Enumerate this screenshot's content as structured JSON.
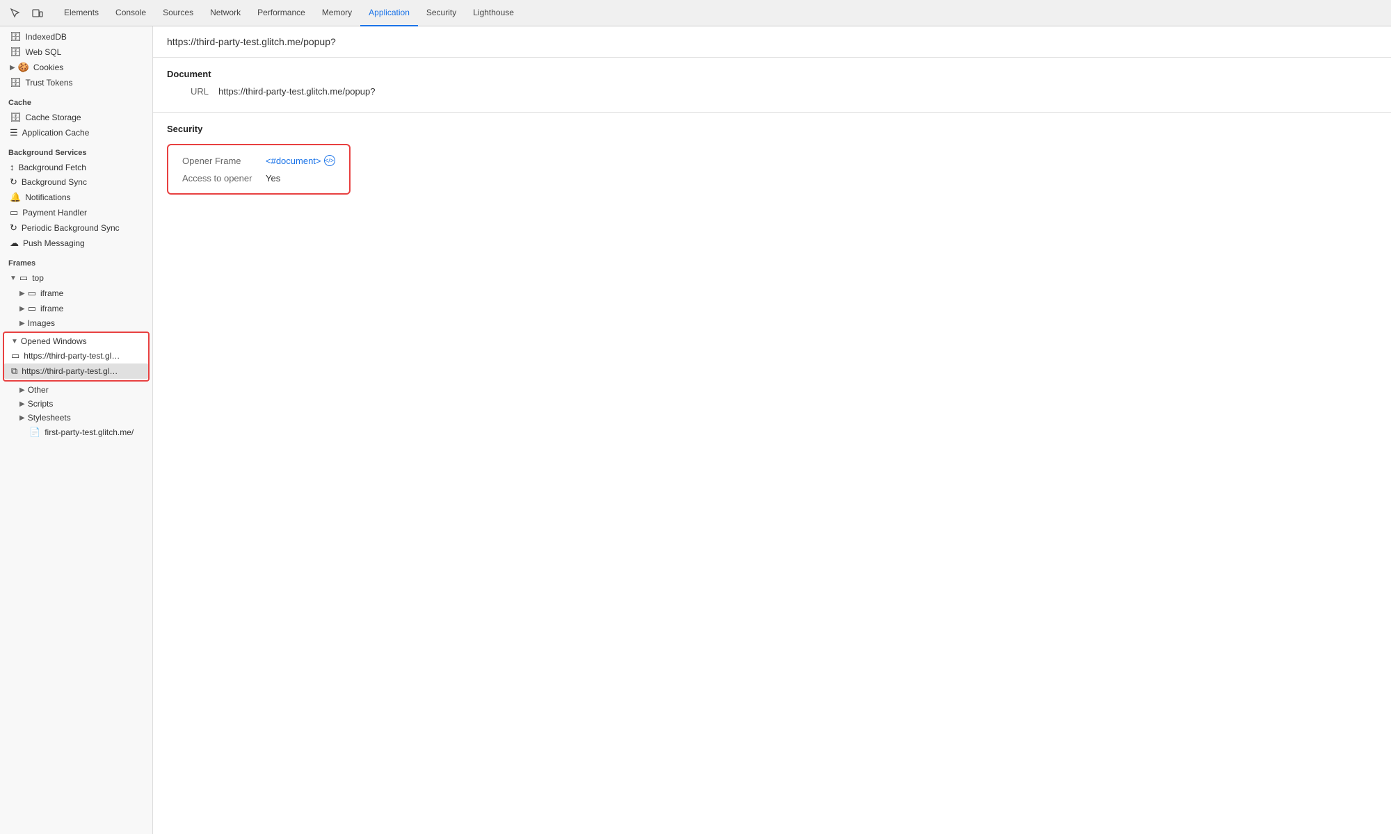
{
  "tabs": [
    {
      "label": "Elements",
      "active": false
    },
    {
      "label": "Console",
      "active": false
    },
    {
      "label": "Sources",
      "active": false
    },
    {
      "label": "Network",
      "active": false
    },
    {
      "label": "Performance",
      "active": false
    },
    {
      "label": "Memory",
      "active": false
    },
    {
      "label": "Application",
      "active": true
    },
    {
      "label": "Security",
      "active": false
    },
    {
      "label": "Lighthouse",
      "active": false
    }
  ],
  "sidebar": {
    "storage_items": [
      {
        "label": "IndexedDB",
        "icon": "🗄",
        "indent": 0
      },
      {
        "label": "Web SQL",
        "icon": "🗄",
        "indent": 0
      },
      {
        "label": "Cookies",
        "icon": "🍪",
        "indent": 0,
        "expandable": true
      },
      {
        "label": "Trust Tokens",
        "icon": "🗄",
        "indent": 0
      }
    ],
    "cache_header": "Cache",
    "cache_items": [
      {
        "label": "Cache Storage",
        "icon": "🗄",
        "indent": 0
      },
      {
        "label": "Application Cache",
        "icon": "☰",
        "indent": 0
      }
    ],
    "bg_header": "Background Services",
    "bg_items": [
      {
        "label": "Background Fetch",
        "icon": "↕",
        "indent": 0
      },
      {
        "label": "Background Sync",
        "icon": "↻",
        "indent": 0
      },
      {
        "label": "Notifications",
        "icon": "🔔",
        "indent": 0
      },
      {
        "label": "Payment Handler",
        "icon": "▭",
        "indent": 0
      },
      {
        "label": "Periodic Background Sync",
        "icon": "↻",
        "indent": 0
      },
      {
        "label": "Push Messaging",
        "icon": "☁",
        "indent": 0
      }
    ],
    "frames_header": "Frames",
    "frames_items": [
      {
        "label": "top",
        "icon": "▭",
        "indent": 0,
        "expandable": true,
        "expanded": true
      },
      {
        "label": "iframe",
        "icon": "▭",
        "indent": 1,
        "expandable": true
      },
      {
        "label": "iframe",
        "icon": "▭",
        "indent": 1,
        "expandable": true
      },
      {
        "label": "Images",
        "icon": "",
        "indent": 1,
        "expandable": true
      }
    ],
    "opened_windows_label": "Opened Windows",
    "opened_windows_items": [
      {
        "label": "https://third-party-test.glitch.",
        "icon": "▭",
        "selected": false
      },
      {
        "label": "https://third-party-test.glitch.",
        "icon": "⧉",
        "selected": true
      }
    ],
    "other_items": [
      {
        "label": "Other",
        "icon": "",
        "indent": 1,
        "expandable": true
      },
      {
        "label": "Scripts",
        "icon": "",
        "indent": 1,
        "expandable": true
      },
      {
        "label": "Stylesheets",
        "icon": "",
        "indent": 1,
        "expandable": true
      },
      {
        "label": "first-party-test.glitch.me/",
        "icon": "📄",
        "indent": 2
      }
    ]
  },
  "content": {
    "url": "https://third-party-test.glitch.me/popup?",
    "document_heading": "Document",
    "url_label": "URL",
    "url_value": "https://third-party-test.glitch.me/popup?",
    "security_heading": "Security",
    "opener_frame_label": "Opener Frame",
    "opener_frame_link": "<#document>",
    "access_opener_label": "Access to opener",
    "access_opener_value": "Yes"
  }
}
